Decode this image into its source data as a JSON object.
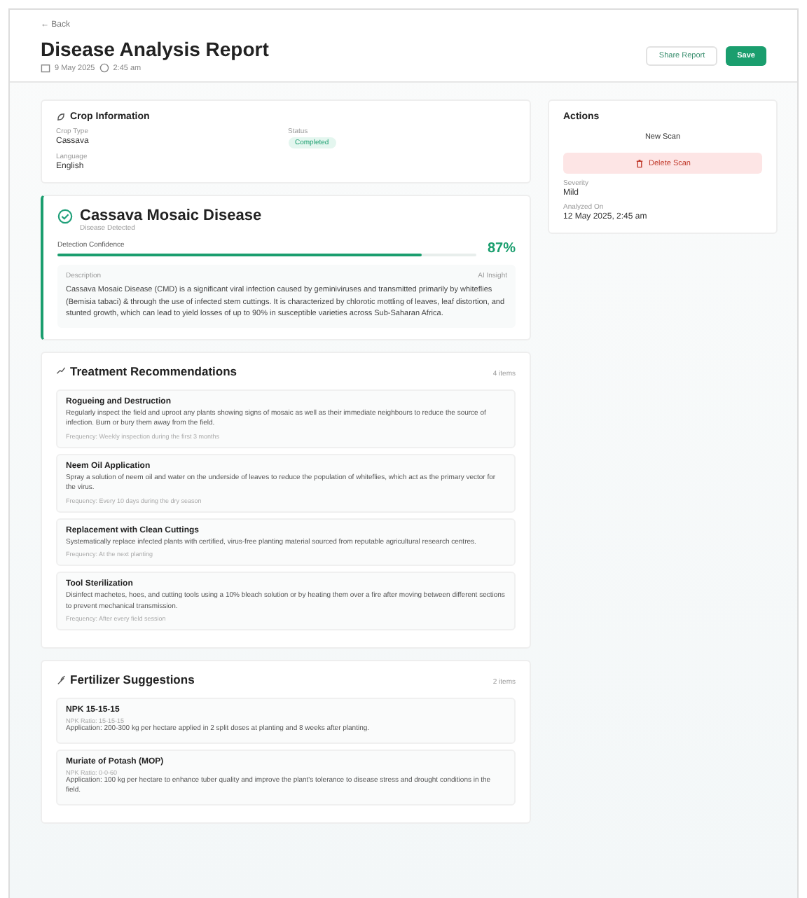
{
  "back_link": "← Back",
  "header": {
    "title": "Disease Analysis Report",
    "date": "9 May 2025",
    "time": "2:45 am",
    "buttons": [
      {
        "label": "Share Report",
        "kind": "outline"
      },
      {
        "label": "Save",
        "kind": "primary"
      }
    ]
  },
  "crop_info": {
    "title": "Crop Information",
    "fields": [
      {
        "label": "Crop Type",
        "value": "Cassava",
        "kind": "text"
      },
      {
        "label": "Status",
        "value": "Completed",
        "kind": "badge"
      },
      {
        "label": "Language",
        "value": "English",
        "kind": "text"
      }
    ]
  },
  "diagnosis": {
    "name": "Cassava Mosaic Disease",
    "subtitle": "Disease Detected",
    "confidence_label": "Detection Confidence",
    "confidence": "87%",
    "level": 0.87,
    "description_label": "Description",
    "description_tag": "AI Insight",
    "description": "Cassava Mosaic Disease (CMD) is a significant viral infection caused by geminiviruses and transmitted primarily by whiteflies (Bemisia tabaci) & through the use of infected stem cuttings. It is characterized by chlorotic mottling of leaves, leaf distortion, and stunted growth, which can lead to yield losses of up to 90% in susceptible varieties across Sub-Saharan Africa."
  },
  "treatment": {
    "title": "Treatment Recommendations",
    "count": "4 items",
    "items": [
      {
        "title": "Rogueing and Destruction",
        "text": "Regularly inspect the field and uproot any plants showing signs of mosaic as well as their immediate neighbours to reduce the source of infection. Burn or bury them away from the field.",
        "note": "Frequency: Weekly inspection during the first 3 months"
      },
      {
        "title": "Neem Oil Application",
        "text": "Spray a solution of neem oil and water on the underside of leaves to reduce the population of whiteflies, which act as the primary vector for the virus.",
        "note": "Frequency: Every 10 days during the dry season"
      },
      {
        "title": "Replacement with Clean Cuttings",
        "text": "Systematically replace infected plants with certified, virus-free planting material sourced from reputable agricultural research centres.",
        "note": "Frequency: At the next planting"
      },
      {
        "title": "Tool Sterilization",
        "text": "Disinfect machetes, hoes, and cutting tools using a 10% bleach solution or by heating them over a fire after moving between different sections to prevent mechanical transmission.",
        "note": "Frequency: After every field session"
      }
    ]
  },
  "fertilizer": {
    "title": "Fertilizer Suggestions",
    "count": "2 items",
    "items": [
      {
        "title": "NPK 15-15-15",
        "ratio": "NPK Ratio: 15-15-15",
        "text": "Application: 200-300 kg per hectare applied in 2 split doses at planting and 8 weeks after planting."
      },
      {
        "title": "Muriate of Potash (MOP)",
        "ratio": "NPK Ratio: 0-0-60",
        "text": "Application: 100 kg per hectare to enhance tuber quality and improve the plant's tolerance to disease stress and drought conditions in the field."
      }
    ]
  },
  "actions": {
    "title": "Actions",
    "buttons": [
      {
        "label": "New Scan",
        "kind": "plain"
      },
      {
        "label": "Delete Scan",
        "kind": "danger"
      }
    ],
    "details": [
      {
        "label": "Severity",
        "value": "Mild"
      },
      {
        "label": "Analyzed On",
        "value": "12 May 2025, 2:45 am"
      }
    ]
  }
}
